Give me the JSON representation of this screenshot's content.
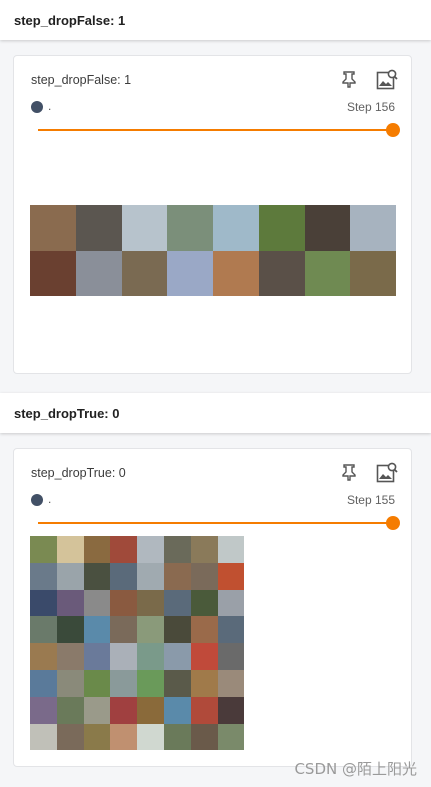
{
  "sections": [
    {
      "header": "step_dropFalse: 1",
      "card": {
        "title": "step_dropFalse: 1",
        "run_name": ".",
        "step": "Step 156",
        "slider_value": 1.0,
        "grid_cols": 8,
        "grid_rows": 2,
        "cell_colors": [
          "#8a6b4f",
          "#5b5650",
          "#b7c3cc",
          "#7b8f7a",
          "#9fb9c9",
          "#5d7a3c",
          "#4a4038",
          "#a7b3bf",
          "#6a4030",
          "#8a8f99",
          "#7a6a52",
          "#9aa8c6",
          "#b07a50",
          "#5a5048",
          "#6f8a52",
          "#7a6a4a"
        ]
      }
    },
    {
      "header": "step_dropTrue: 0",
      "card": {
        "title": "step_dropTrue: 0",
        "run_name": ".",
        "step": "Step 155",
        "slider_value": 1.0,
        "grid_cols": 8,
        "grid_rows": 8,
        "cell_colors": [
          "#7a8a52",
          "#d4c39a",
          "#8a6a40",
          "#a04a3a",
          "#b0b8bf",
          "#6a6a5a",
          "#8a7a5a",
          "#c0c8c8",
          "#6a7a8a",
          "#9aa4aa",
          "#4a5040",
          "#5a6a7a",
          "#a0aab0",
          "#8a6a50",
          "#7a6a5a",
          "#c05030",
          "#3a4a6a",
          "#6a5a7a",
          "#8a8a8a",
          "#8a5a40",
          "#7a6a4a",
          "#5a6a7a",
          "#4a5a3a",
          "#9aa0a8",
          "#6a7a6a",
          "#3a4a3a",
          "#5a8aaa",
          "#7a6a5a",
          "#8a9a7a",
          "#4a4a3a",
          "#9a6a4a",
          "#5a6a7a",
          "#9a7a50",
          "#8a7a6a",
          "#6a7a9a",
          "#aab0b8",
          "#7a9a8a",
          "#8a9aaa",
          "#c04a3a",
          "#6a6a6a",
          "#5a7a9a",
          "#8a8a7a",
          "#6a8a4a",
          "#8a9a9a",
          "#6a9a5a",
          "#5a5a4a",
          "#a07a4a",
          "#9a8a7a",
          "#7a6a8a",
          "#6a7a5a",
          "#9a9a8a",
          "#a04040",
          "#8a6a3a",
          "#5a8aaa",
          "#b04a3a",
          "#4a3a3a",
          "#c0c0b8",
          "#7a6a5a",
          "#8a7a4a",
          "#c09070",
          "#d0d8d0",
          "#6a7a5a",
          "#6a5a4a",
          "#7a8a6a"
        ]
      }
    }
  ],
  "watermark": "CSDN @陌上阳光"
}
